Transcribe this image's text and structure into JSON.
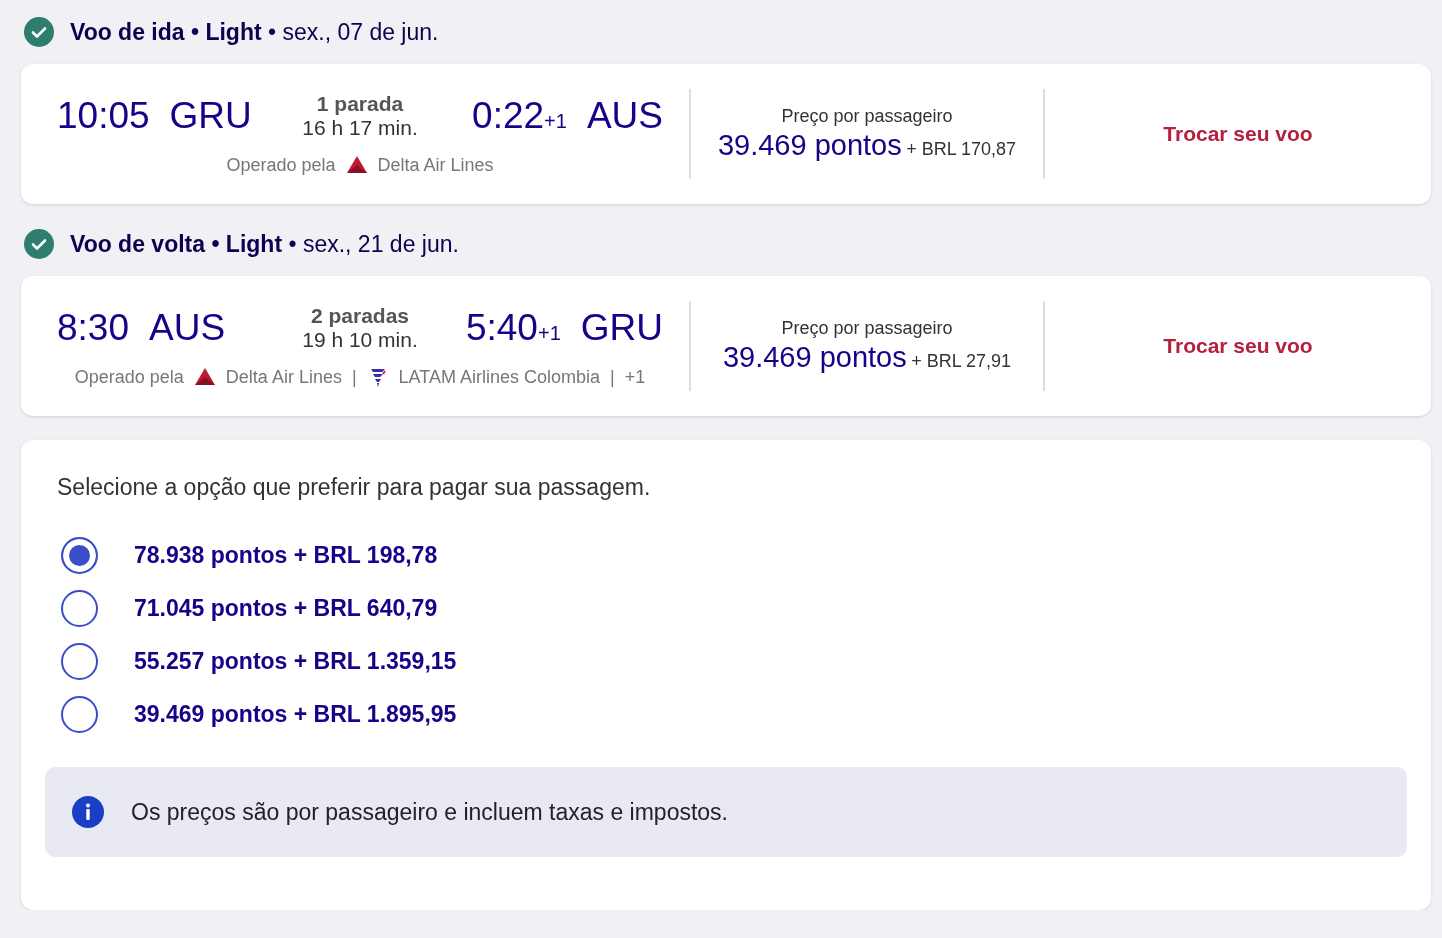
{
  "flights": [
    {
      "header": "**Voo de ida • Light** • sex., 07 de jun.",
      "confirmed": true,
      "depart_time": "10:05",
      "depart_airport": "GRU",
      "stops": "1 parada",
      "duration": "16 h 17 min.",
      "arrive_time": "0:22",
      "arrive_day": "+1",
      "arrive_airport": "AUS",
      "operated": [
        {
          "kind": "label",
          "text": "Operado pela"
        },
        {
          "kind": "delta",
          "text": "Delta Air Lines"
        }
      ],
      "price_label": "Preço por passageiro",
      "points": "39.469 pontos",
      "cash": "+ BRL 170,87",
      "change": "Trocar seu voo"
    },
    {
      "header": "**Voo de volta • Light** • sex., 21 de jun.",
      "confirmed": true,
      "depart_time": "8:30",
      "depart_airport": "AUS",
      "stops": "2 paradas",
      "duration": "19 h 10 min.",
      "arrive_time": "5:40",
      "arrive_day": "+1",
      "arrive_airport": "GRU",
      "operated": [
        {
          "kind": "label",
          "text": "Operado pela"
        },
        {
          "kind": "delta",
          "text": "Delta Air Lines"
        },
        {
          "kind": "sep",
          "text": "|"
        },
        {
          "kind": "latam",
          "text": "LATAM Airlines Colombia"
        },
        {
          "kind": "sep",
          "text": "|"
        },
        {
          "kind": "more",
          "text": "+1"
        }
      ],
      "price_label": "Preço por passageiro",
      "points": "39.469 pontos",
      "cash": "+ BRL 27,91",
      "change": "Trocar seu voo"
    }
  ],
  "payment": {
    "prompt": "Selecione a opção que preferir para pagar sua passagem.",
    "options": [
      {
        "label": "78.938 pontos + BRL 198,78",
        "selected": true
      },
      {
        "label": "71.045 pontos + BRL 640,79",
        "selected": false
      },
      {
        "label": "55.257 pontos + BRL 1.359,15",
        "selected": false
      },
      {
        "label": "39.469 pontos + BRL 1.895,95",
        "selected": false
      }
    ],
    "note": "Os preços são por passageiro e incluem taxas e impostos."
  }
}
